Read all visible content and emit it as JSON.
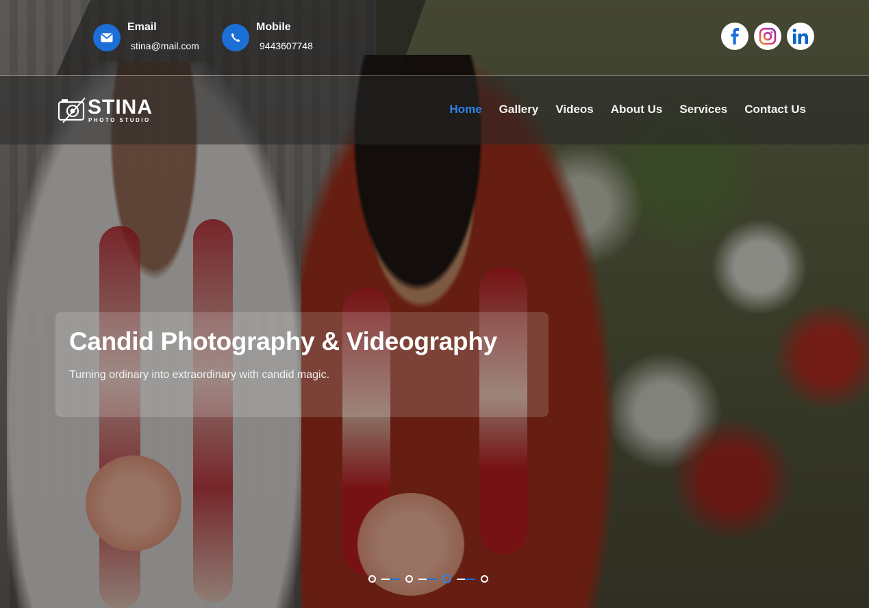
{
  "contact": {
    "email": {
      "label": "Email",
      "value": "stina@mail.com",
      "icon": "envelope-icon"
    },
    "mobile": {
      "label": "Mobile",
      "value": "9443607748",
      "icon": "phone-icon"
    }
  },
  "social": [
    {
      "name": "facebook",
      "icon": "facebook-icon"
    },
    {
      "name": "instagram",
      "icon": "instagram-icon"
    },
    {
      "name": "linkedin",
      "icon": "linkedin-icon"
    }
  ],
  "logo": {
    "title": "STINA",
    "subtitle": "PHOTO STUDIO"
  },
  "nav": {
    "items": [
      "Home",
      "Gallery",
      "Videos",
      "About Us",
      "Services",
      "Contact Us"
    ],
    "active": "Home"
  },
  "hero": {
    "title": "Candid Photography & Videography",
    "subtitle": "Turning ordinary into extraordinary with candid magic."
  },
  "slider": {
    "slide_count": 4,
    "active_index": 2
  },
  "colors": {
    "accent": "#2d82ea",
    "icon_bg": "#1b6fd6"
  }
}
